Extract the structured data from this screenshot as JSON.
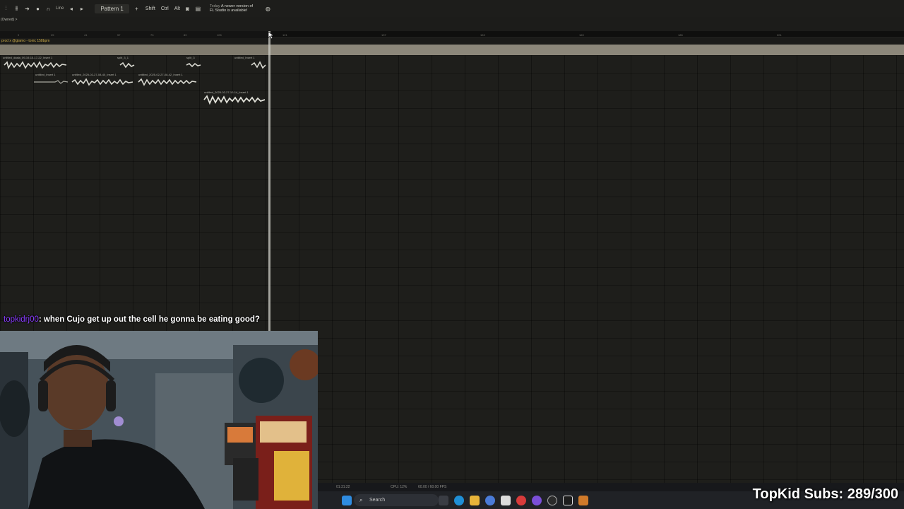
{
  "toolbar": {
    "tempo_mode": "Line",
    "pattern": "Pattern 1",
    "modifiers": [
      "Shift",
      "Ctrl",
      "Alt"
    ],
    "news_date": "Today",
    "news_line1": "A newer version of",
    "news_line2": "FL Studio is available!"
  },
  "browser": {
    "owned_label": "(Owned) >"
  },
  "ruler": {
    "ticks": [
      "9",
      "25",
      "41",
      "57",
      "73",
      "89",
      "105",
      "121",
      "137",
      "153",
      "169",
      "185",
      "201"
    ]
  },
  "project": {
    "title": "prod x @glamo - tonic 158bpm"
  },
  "clips": [
    {
      "name": "untitled_dasta_09-19-10-17-22_Insert 1"
    },
    {
      "name": "split_3_1"
    },
    {
      "name": "split_3"
    },
    {
      "name": "untitled_Insert 1"
    },
    {
      "name": "untitled_Insert 1"
    },
    {
      "name": "untitled_2025-02-27-08-40_Insert 1"
    },
    {
      "name": "untitled_2025-02-27-08-42_Insert 1"
    },
    {
      "name": "untitled_2025-02-27-10-14_Insert 1"
    }
  ],
  "chat": {
    "username": "topkidrj00",
    "message": ": when Cujo get up out the cell he gonna be eating good?"
  },
  "taskbar": {
    "search_placeholder": "Search",
    "tray_left": "01:31:22",
    "tray_mid": "CPU: 12%",
    "tray_right": "60.00 / 60.00 FPS"
  },
  "overlay": {
    "subs_text": "TopKid Subs: 289/300"
  },
  "colors": {
    "chat_user": "#8a3cff",
    "marker_band": "#8c877a",
    "project_title": "#d2b04a"
  }
}
